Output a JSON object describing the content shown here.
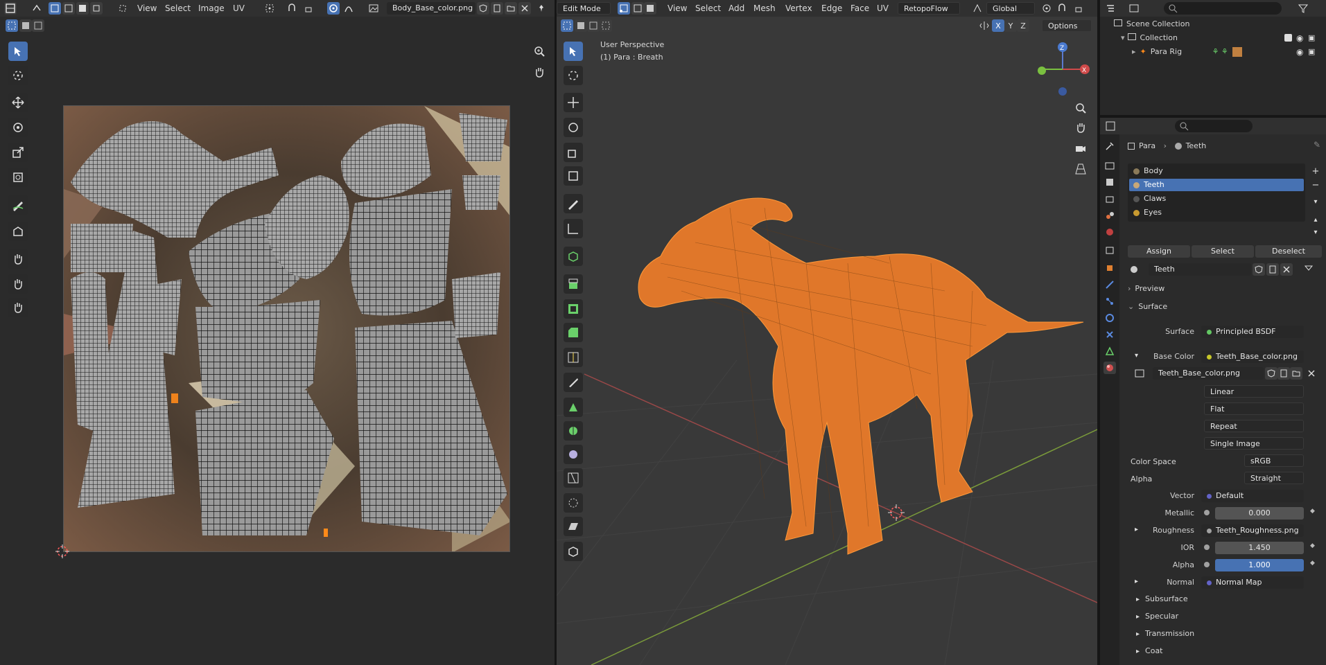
{
  "uv_editor": {
    "menus": [
      "View",
      "Select",
      "Image",
      "UV"
    ],
    "image_name": "Body_Base_color.png"
  },
  "viewport": {
    "mode": "Edit Mode",
    "menus": [
      "View",
      "Select",
      "Add",
      "Mesh",
      "Vertex",
      "Edge",
      "Face",
      "UV"
    ],
    "addon_menu": "RetopoFlow",
    "transform_orientation": "Global",
    "options_label": "Options",
    "axes": [
      "X",
      "Y",
      "Z"
    ],
    "overlay_line1": "User Perspective",
    "overlay_line2": "(1) Para : Breath"
  },
  "outliner": {
    "scene_collection": "Scene Collection",
    "collection": "Collection",
    "item": "Para Rig"
  },
  "properties": {
    "breadcrumb": [
      "Para",
      "Teeth"
    ],
    "material_slots": [
      "Body",
      "Teeth",
      "Claws",
      "Eyes"
    ],
    "selected_slot": "Teeth",
    "buttons": {
      "assign": "Assign",
      "select": "Select",
      "deselect": "Deselect"
    },
    "material_name": "Teeth",
    "preview_label": "Preview",
    "surface_section": "Surface",
    "surface": {
      "label": "Surface",
      "value": "Principled BSDF"
    },
    "base_color": {
      "label": "Base Color",
      "value": "Teeth_Base_color.png",
      "image": "Teeth_Base_color.png"
    },
    "image_settings": [
      "Linear",
      "Flat",
      "Repeat",
      "Single Image"
    ],
    "color_space": {
      "label": "Color Space",
      "value": "sRGB"
    },
    "alpha_mode": {
      "label": "Alpha",
      "value": "Straight"
    },
    "vector": {
      "label": "Vector",
      "value": "Default"
    },
    "metallic": {
      "label": "Metallic",
      "value": "0.000"
    },
    "roughness": {
      "label": "Roughness",
      "value": "Teeth_Roughness.png"
    },
    "ior": {
      "label": "IOR",
      "value": "1.450"
    },
    "alpha": {
      "label": "Alpha",
      "value": "1.000"
    },
    "normal": {
      "label": "Normal",
      "value": "Normal Map"
    },
    "subsections": [
      "Subsurface",
      "Specular",
      "Transmission",
      "Coat"
    ]
  },
  "colors": {
    "accent": "#4772b3",
    "mesh_orange": "#ff8a1a",
    "socket_yellow": "#c7c729",
    "socket_green": "#63c763",
    "socket_purple": "#6363c7",
    "socket_gray": "#a1a1a1"
  }
}
